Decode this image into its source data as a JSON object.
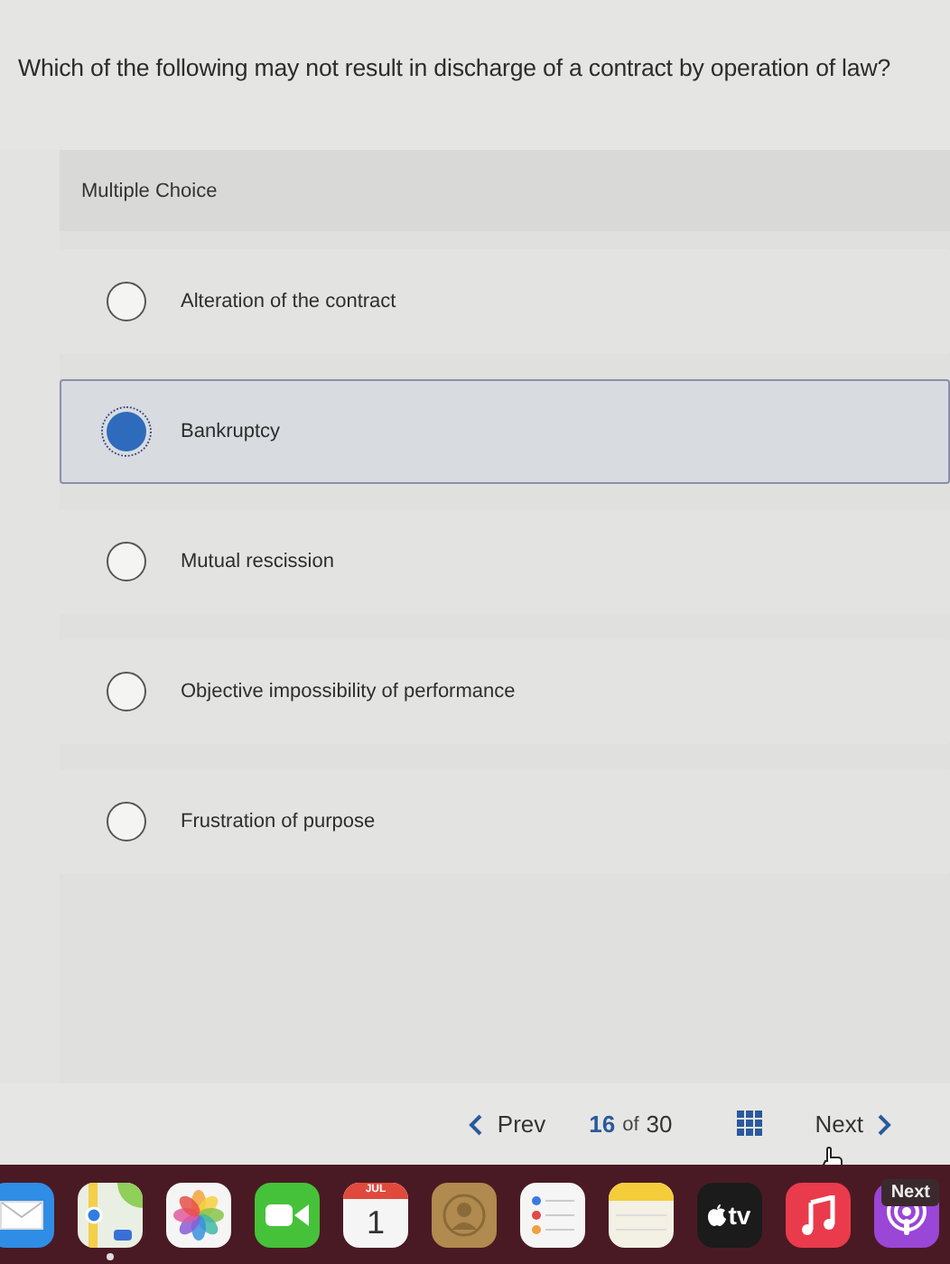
{
  "question": "Which of the following may not result in discharge of a contract by operation of law?",
  "section_label": "Multiple Choice",
  "options": [
    {
      "label": "Alteration of the contract",
      "selected": false
    },
    {
      "label": "Bankruptcy",
      "selected": true
    },
    {
      "label": "Mutual rescission",
      "selected": false
    },
    {
      "label": "Objective impossibility of performance",
      "selected": false
    },
    {
      "label": "Frustration of purpose",
      "selected": false
    }
  ],
  "nav": {
    "prev": "Prev",
    "current": "16",
    "of": "of",
    "total": "30",
    "next": "Next"
  },
  "dock": {
    "tooltip": "Next",
    "apps": [
      {
        "kind": "mail",
        "running": false
      },
      {
        "kind": "maps",
        "running": true
      },
      {
        "kind": "photos",
        "running": false
      },
      {
        "kind": "facetime",
        "running": false
      },
      {
        "kind": "calendar",
        "month": "JUL",
        "day": "1",
        "running": false
      },
      {
        "kind": "contacts",
        "running": false
      },
      {
        "kind": "reminders",
        "running": false
      },
      {
        "kind": "notes",
        "running": false
      },
      {
        "kind": "tv",
        "label": "tv",
        "running": false
      },
      {
        "kind": "music",
        "running": false
      },
      {
        "kind": "podcasts",
        "running": false
      }
    ]
  }
}
